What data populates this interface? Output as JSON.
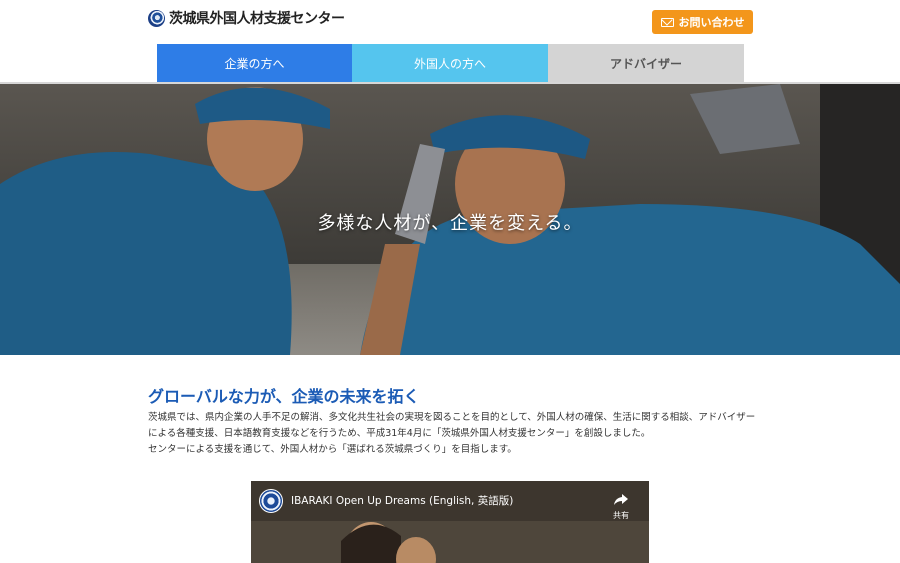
{
  "header": {
    "logo_text": "茨城県外国人材支援センター",
    "contact_label": "お問い合わせ"
  },
  "nav": {
    "tabs": [
      {
        "label": "企業の方へ"
      },
      {
        "label": "外国人の方へ"
      },
      {
        "label": "アドバイザー"
      }
    ]
  },
  "hero": {
    "tagline": "多様な人材が、企業を変える。"
  },
  "intro": {
    "title": "グローバルな力が、企業の未来を拓く",
    "paragraphs": [
      "茨城県では、県内企業の人手不足の解消、多文化共生社会の実現を図ることを目的として、外国人材の確保、生活に関する相談、アドバイザーによる各種支援、日本語教育支援などを行うため、平成31年4月に「茨城県外国人材支援センター」を創設しました。",
      "センターによる支援を通じて、外国人材から「選ばれる茨城県づくり」を目指します。"
    ]
  },
  "video": {
    "title": "IBARAKI Open Up Dreams (English, 英語版)",
    "share_label": "共有"
  },
  "colors": {
    "primary_tab": "#2e7de7",
    "secondary_tab": "#55c5ee",
    "advisor_tab": "#d4d4d4",
    "contact": "#f3961b",
    "heading": "#1b5bb5"
  }
}
